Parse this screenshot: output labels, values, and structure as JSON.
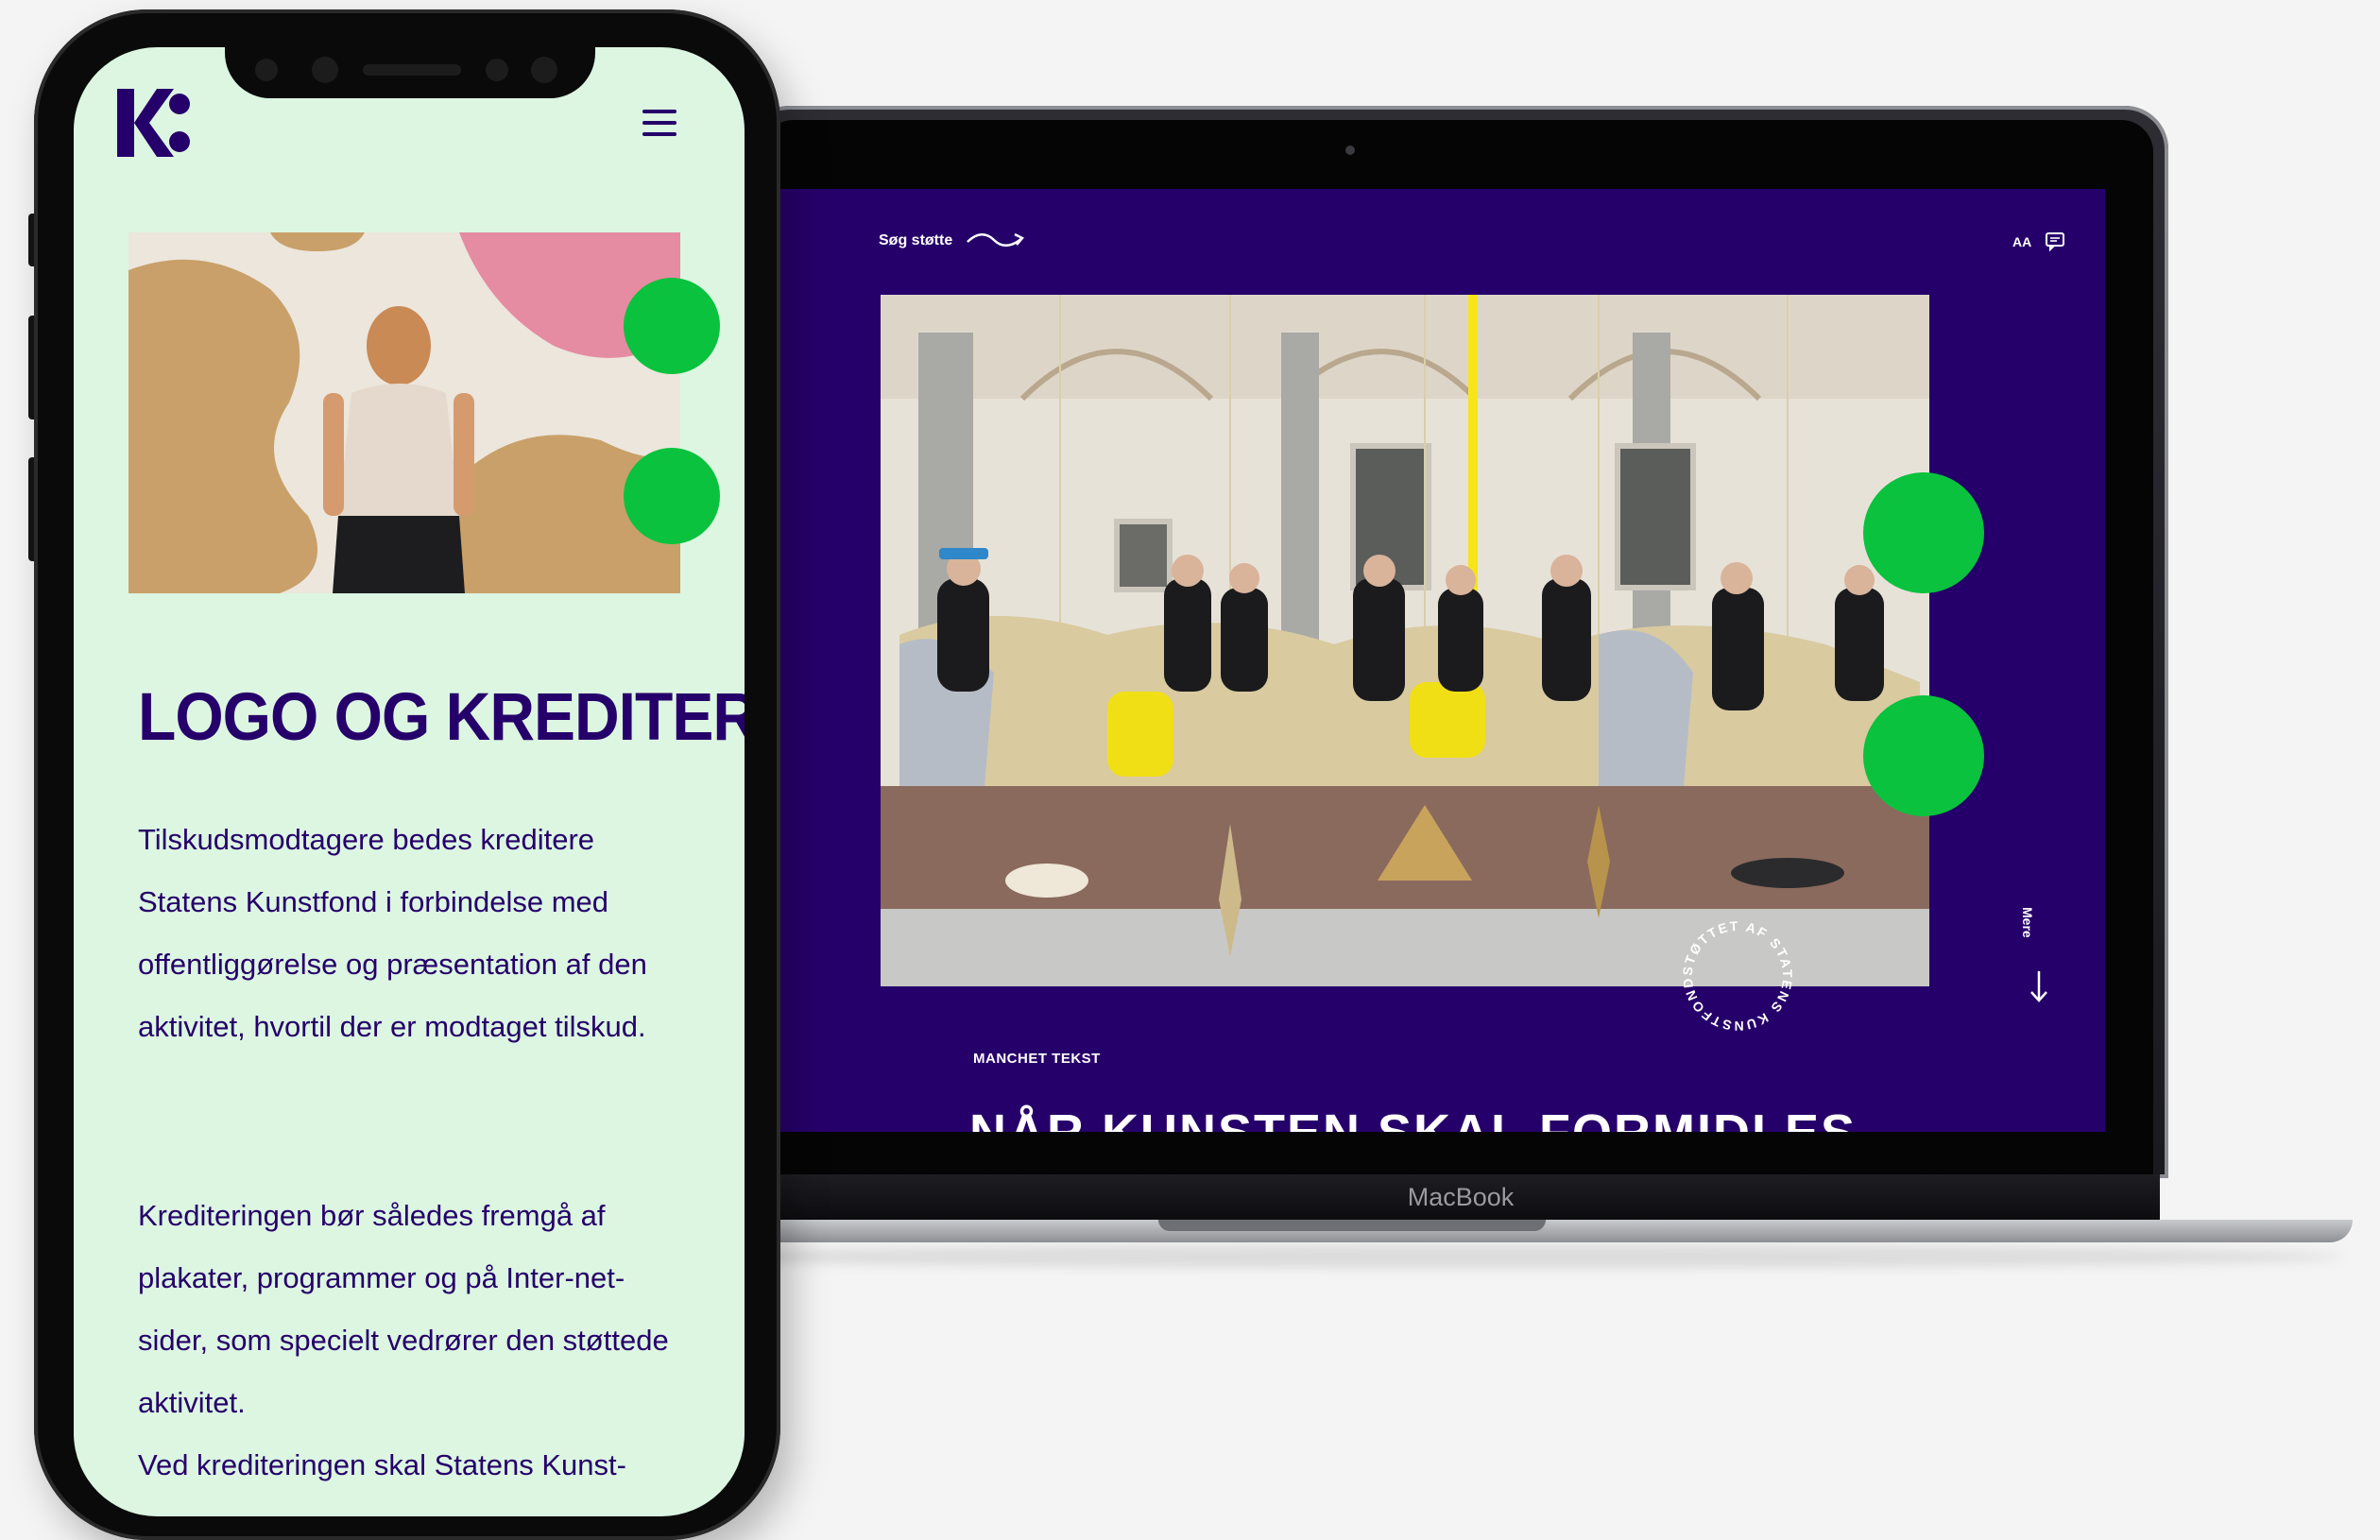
{
  "laptop": {
    "brand_label": "MacBook",
    "nav_link": "Søg støtte",
    "text_size_toggle": "AA",
    "side_label": "Mere",
    "badge_text": "STØTTET AF STATENS KUNSTFOND",
    "kicker": "MANCHET TEKST",
    "headline": "NÅR KUNSTEN SKAL FORMIDLES"
  },
  "phone": {
    "logo_text": "K:",
    "title": "LOGO OG KREDITERING",
    "paragraph_1": "Tilskudsmodtagere bedes kreditere Statens Kunstfond i forbindelse med offentliggørelse og præsentation af den aktivitet, hvortil der er modtaget tilskud.",
    "paragraph_2": "Krediteringen bør således fremgå af plakater, programmer og på Inter-net-sider, som specielt vedrører den støttede aktivitet.",
    "paragraph_3": "Ved krediteringen skal Statens Kunst-"
  },
  "colors": {
    "brand_purple": "#26006a",
    "mint_background": "#dcf6e2",
    "accent_green": "#0ac23d",
    "accent_yellow": "#f6e51a"
  },
  "icons": [
    "menu-icon",
    "squiggle-arrow-icon",
    "chat-icon",
    "arrow-down-icon"
  ]
}
